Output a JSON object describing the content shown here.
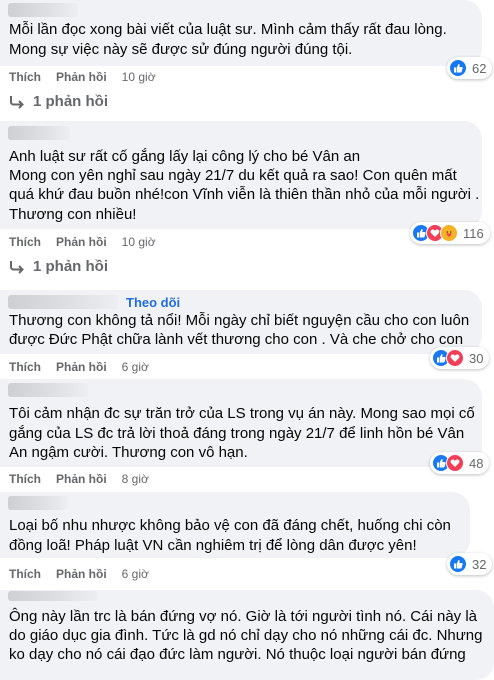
{
  "comments": [
    {
      "lines": [
        "Mỗi lần đọc xong bài viết của luật sư. Mình cảm thấy rất đau lòng.",
        "Mong sự việc này sẽ được sử đúng người đúng tội."
      ],
      "like_label": "Thích",
      "reply_label": "Phản hồi",
      "time": "10 giờ",
      "reactions": [
        "like-icon"
      ],
      "reaction_count": "62",
      "replies": "1 phản hồi"
    },
    {
      "lines": [
        "Anh luật sư rất cố gắng lấy lại công lý cho bé Vân an",
        "Mong con yên nghỉ sau ngày 21/7 du kết quả ra sao! Con quên mất",
        "quá khứ đau buồn nhé!con Vĩnh viễn là thiên thần nhỏ của mỗi người .",
        "Thương con nhiều!"
      ],
      "like_label": "Thích",
      "reply_label": "Phản hồi",
      "time": "10 giờ",
      "reactions": [
        "like-icon",
        "love-icon",
        "care-icon"
      ],
      "reaction_count": "116",
      "replies": "1 phản hồi"
    },
    {
      "follow": "Theo dõi",
      "lines": [
        "Thương con không tả nổi! Mỗi ngày chỉ biết nguyện cầu cho con luôn",
        "được Đức Phật chữa lành vết thương cho con . Và che chở cho con"
      ],
      "like_label": "Thích",
      "reply_label": "Phản hồi",
      "time": "6 giờ",
      "reactions": [
        "like-icon",
        "love-icon"
      ],
      "reaction_count": "30"
    },
    {
      "lines": [
        "Tôi cảm nhận đc sự trăn trở của LS trong vụ án này. Mong sao mọi cố",
        "gắng của LS đc trả lời thoả đáng trong ngày 21/7 để linh hồn bé Vân",
        "An ngậm cười. Thương con vô hạn."
      ],
      "like_label": "Thích",
      "reply_label": "Phản hồi",
      "time": "8 giờ",
      "reactions": [
        "like-icon",
        "love-icon"
      ],
      "reaction_count": "48"
    },
    {
      "lines": [
        "Loại bố nhu nhược không bảo vệ con đã đáng chết, huống chi còn",
        "đồng loã! Pháp luật VN cần nghiêm trị để lòng dân được yên!"
      ],
      "like_label": "Thích",
      "reply_label": "Phản hồi",
      "time": "6 giờ",
      "reactions": [
        "like-icon"
      ],
      "reaction_count": "32"
    },
    {
      "lines": [
        "Ông này lần trc là bán đứng vợ nó. Giờ là tới người tình nó. Cái này là",
        "do giáo dục gia đình. Tức là gd nó chỉ dạy cho nó những cái đc. Nhưng",
        "ko dạy cho nó cái đạo đức làm người. Nó thuộc loại người bán đứng"
      ]
    }
  ],
  "colors": {
    "like": "#1877f2",
    "love": "#f33e58",
    "care": "#f7b125",
    "bubble": "#f0f2f5",
    "meta": "#65676b",
    "follow": "#216fdb"
  }
}
